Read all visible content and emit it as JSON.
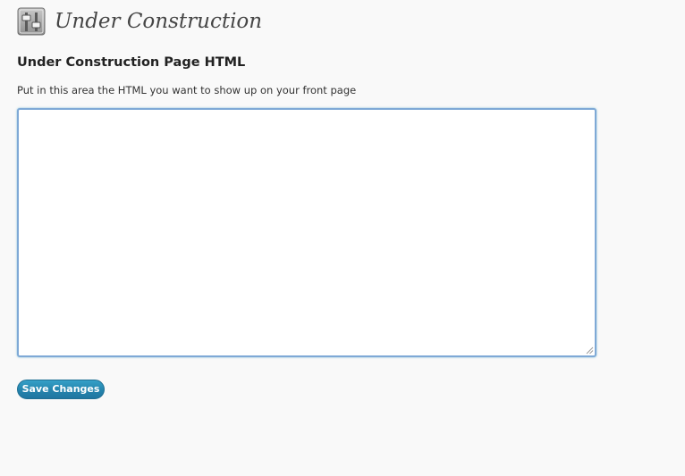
{
  "header": {
    "icon": "settings-sliders-icon",
    "title": "Under Construction"
  },
  "section": {
    "heading": "Under Construction Page HTML",
    "description": "Put in this area the HTML you want to show up on your front page"
  },
  "editor": {
    "value": ""
  },
  "actions": {
    "save_label": "Save Changes"
  },
  "colors": {
    "background": "#f9f9f9",
    "textarea_border": "#7fa9d6",
    "button": "#2584ad",
    "title": "#464646"
  }
}
